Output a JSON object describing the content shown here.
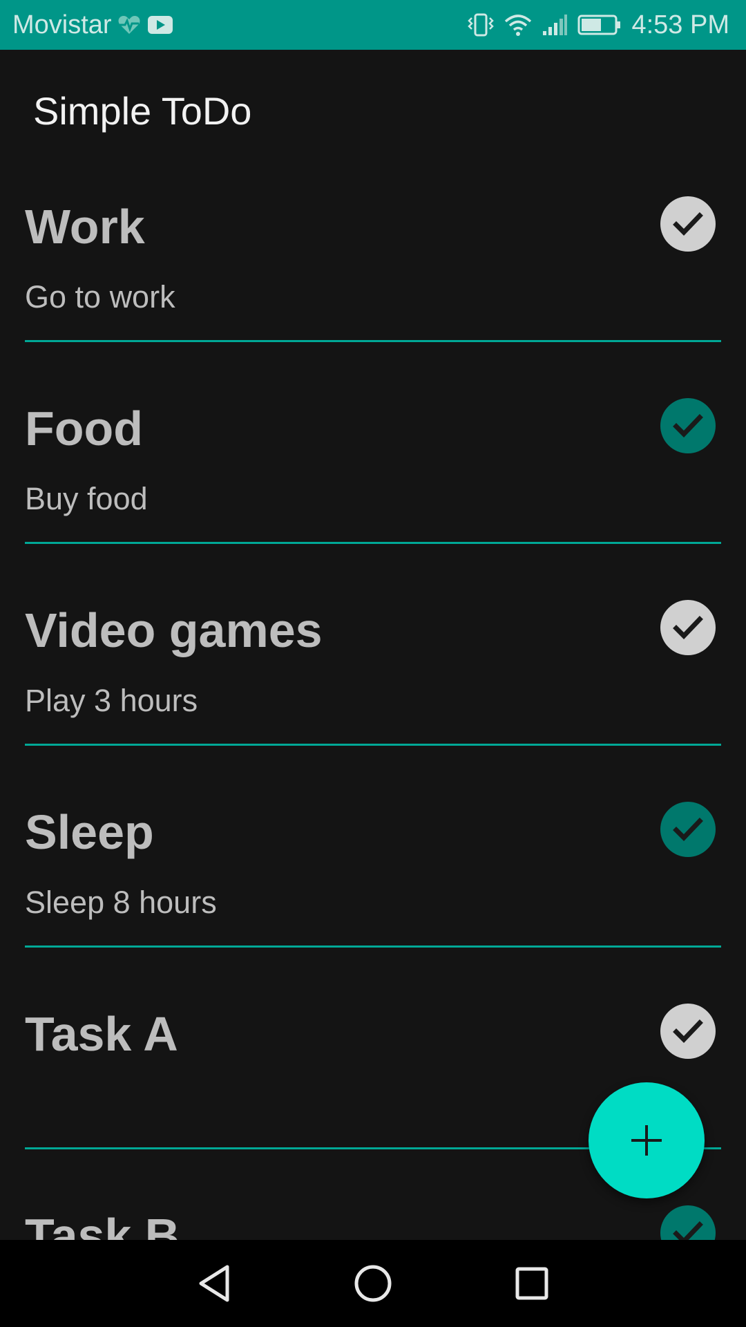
{
  "status_bar": {
    "carrier": "Movistar",
    "time": "4:53 PM",
    "icons": [
      "heart-pulse-icon",
      "youtube-icon",
      "vibrate-icon",
      "wifi-icon",
      "signal-icon",
      "battery-icon"
    ]
  },
  "app_bar": {
    "title": "Simple ToDo"
  },
  "tasks": [
    {
      "title": "Work",
      "description": "Go to work",
      "done": false
    },
    {
      "title": "Food",
      "description": "Buy food",
      "done": true
    },
    {
      "title": "Video games",
      "description": "Play 3 hours",
      "done": false
    },
    {
      "title": "Sleep",
      "description": "Sleep 8 hours",
      "done": true
    },
    {
      "title": "Task A",
      "description": "",
      "done": false
    },
    {
      "title": "Task B",
      "description": "",
      "done": true
    }
  ],
  "fab": {
    "icon": "plus-icon"
  },
  "nav_bar": {
    "icons": [
      "back-icon",
      "home-icon",
      "recents-icon"
    ]
  },
  "colors": {
    "status_bar": "#009688",
    "background": "#141414",
    "accent": "#00dcc4",
    "divider": "#00a896",
    "check_done": "#00786c",
    "check_undone": "#d0d0d0"
  }
}
